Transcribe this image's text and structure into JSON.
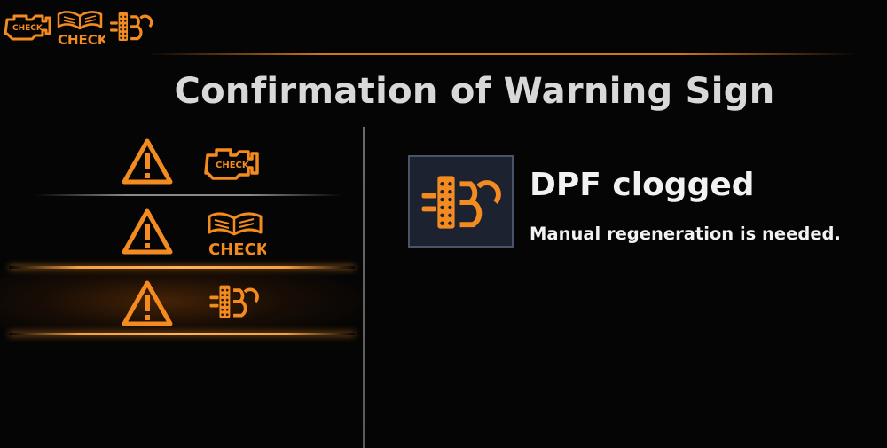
{
  "status_bar": {
    "icons": [
      {
        "name": "check-engine-icon",
        "label": "CHECK"
      },
      {
        "name": "check-manual-icon",
        "label": "CHECK"
      },
      {
        "name": "dpf-icon"
      }
    ]
  },
  "page": {
    "title": "Confirmation of Warning Sign"
  },
  "warning_list": {
    "items": [
      {
        "icon": "check-engine-icon",
        "label": "CHECK",
        "selected": false
      },
      {
        "icon": "check-manual-icon",
        "label": "CHECK",
        "selected": false
      },
      {
        "icon": "dpf-icon",
        "selected": true
      }
    ]
  },
  "detail": {
    "icon": "dpf-icon",
    "title": "DPF clogged",
    "message": "Manual regeneration is needed."
  },
  "colors": {
    "accent": "#f38b20",
    "background": "#050505",
    "text": "#f2f2f2",
    "title_text": "#d8d8d8"
  }
}
